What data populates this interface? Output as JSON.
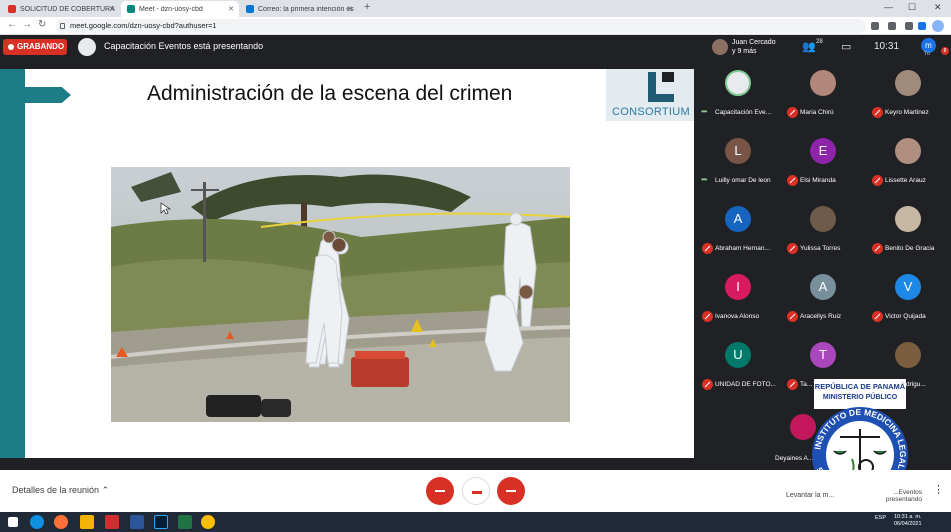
{
  "browser": {
    "tabs": [
      {
        "title": "SOLICITUD DE COBERTURA PARA",
        "favicon_color": "#d93025",
        "active": false
      },
      {
        "title": "Meet - dzn-uosy-cbd",
        "favicon_color": "#00897b",
        "active": true
      },
      {
        "title": "Correo: la primera intención es la",
        "favicon_color": "#0078d4",
        "active": false
      }
    ],
    "url": "meet.google.com/dzn-uosy-cbd?authuser=1"
  },
  "meet": {
    "recording_label": "GRABANDO",
    "presenting_text": "Capacitación Eventos está presentando",
    "self_name_line1": "Juan Cercado",
    "self_name_line2": "y 9 más",
    "people_count": "28",
    "time": "10:31",
    "me_initial": "m",
    "me_label": "Tú",
    "notification_count": "8"
  },
  "slide": {
    "title": "Administración de la escena del crimen",
    "logo_text": "CONSORTIUM",
    "accent_color": "#1c7d86"
  },
  "participants": [
    {
      "name": "Capacitación Eve...",
      "initial": "",
      "color": "#e8eaed",
      "muted": false,
      "presenting": true
    },
    {
      "name": "Maria Chirú",
      "initial": "",
      "color": "#b0877a",
      "muted": true
    },
    {
      "name": "Keyro Martinez",
      "initial": "",
      "color": "#a08a7c",
      "muted": true
    },
    {
      "name": "Luilly omar De leon",
      "initial": "L",
      "color": "#795548",
      "muted": false
    },
    {
      "name": "Elsi Miranda",
      "initial": "E",
      "color": "#8e24aa",
      "muted": true
    },
    {
      "name": "Lissette Arauz",
      "initial": "",
      "color": "#b08e80",
      "muted": true
    },
    {
      "name": "Abraham Hernan...",
      "initial": "A",
      "color": "#1565c0",
      "muted": true
    },
    {
      "name": "Yulissa Torres",
      "initial": "",
      "color": "#6d5a48",
      "muted": true
    },
    {
      "name": "Benito De Gracia",
      "initial": "",
      "color": "#c7b8a4",
      "muted": true
    },
    {
      "name": "Ivanova Alonso",
      "initial": "I",
      "color": "#d81b60",
      "muted": true
    },
    {
      "name": "Aracellys Ruiz",
      "initial": "A",
      "color": "#78909c",
      "muted": true
    },
    {
      "name": "Victor Quijada",
      "initial": "V",
      "color": "#1e88e5",
      "muted": true
    },
    {
      "name": "UNIDAD DE FOTO...",
      "initial": "U",
      "color": "#00796b",
      "muted": true
    },
    {
      "name": "Ta...",
      "initial": "T",
      "color": "#ab47bc",
      "muted": true
    },
    {
      "name": "...th Rodrigu...",
      "initial": "",
      "color": "#7a5c3e",
      "muted": true
    },
    {
      "name": "Deyaines A...",
      "initial": "",
      "color": "#c2185b",
      "muted": true
    }
  ],
  "seal": {
    "top_line1": "REPÚBLICA DE PANAMÁ",
    "top_line2": "MINISTERIO PÚBLICO",
    "ring_text": "INSTITUTO DE MEDICINA LEGAL Y CIENCIAS FORENSES"
  },
  "bottom": {
    "details_label": "Detalles de la reunión",
    "raise_hand_label": "Levantar la m...",
    "presenting_short": "...Eventos presentando"
  },
  "taskbar": {
    "lang": "ESP",
    "time": "10:31 a. m.",
    "date": "06/04/2021"
  }
}
